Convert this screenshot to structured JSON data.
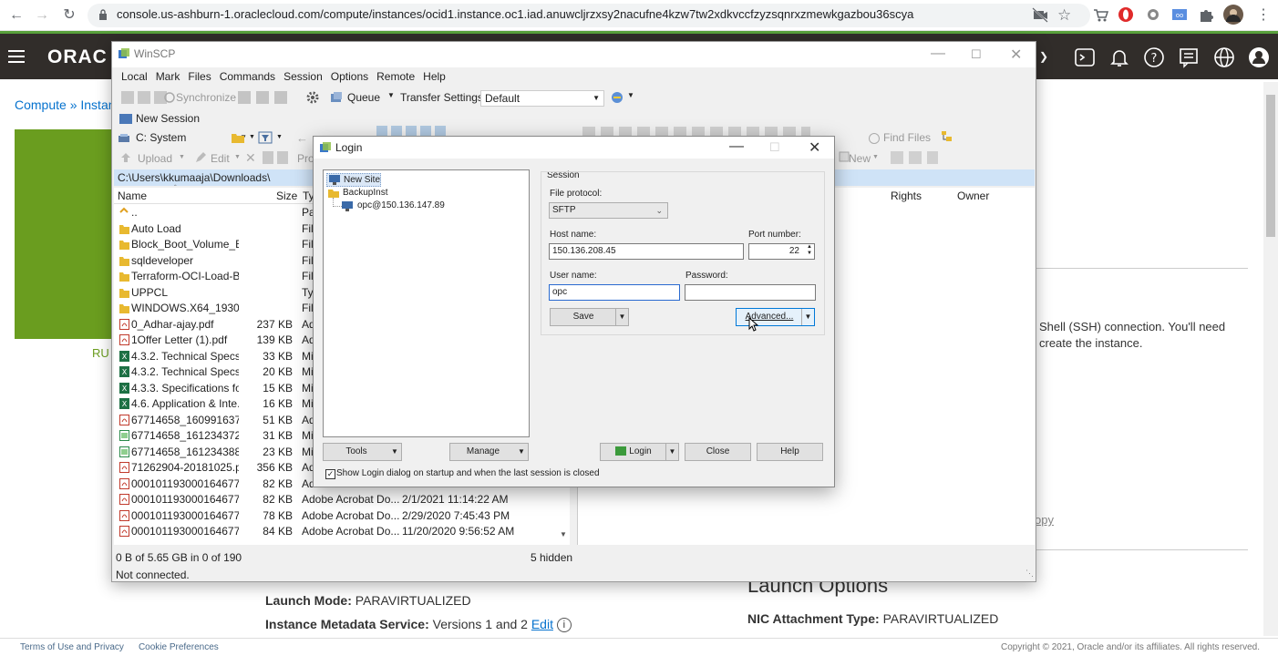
{
  "browser": {
    "url": "console.us-ashburn-1.oraclecloud.com/compute/instances/ocid1.instance.oc1.iad.anuwcljrzxsy2nacufne4kzw7tw2xdkvccfzyzsqnrxzmewkgazbou36scya"
  },
  "oci": {
    "logo": "ORAC",
    "breadcrumb": "Compute » Instanc",
    "run_label": "RU",
    "ssh_text": "Shell (SSH) connection. You'll need create the instance.",
    "copy_link": "opy",
    "launch_mode_label": "Launch Mode:",
    "launch_mode_value": "PARAVIRTUALIZED",
    "imds_label": "Instance Metadata Service:",
    "imds_value": "Versions 1 and 2",
    "imds_edit": "Edit",
    "launch_options": "Launch Options",
    "nic_label": "NIC Attachment Type:",
    "nic_value": "PARAVIRTUALIZED",
    "footer_terms": "Terms of Use and Privacy",
    "footer_cookies": "Cookie Preferences",
    "copyright": "Copyright © 2021, Oracle and/or its affiliates. All rights reserved."
  },
  "winscp": {
    "title": "WinSCP",
    "menu": [
      "Local",
      "Mark",
      "Files",
      "Commands",
      "Session",
      "Options",
      "Remote",
      "Help"
    ],
    "synchronize": "Synchronize",
    "queue": "Queue",
    "transfer_settings": "Transfer Settings",
    "transfer_value": "Default",
    "new_session": "New Session",
    "drive": "C: System",
    "upload": "Upload",
    "edit": "Edit",
    "pro": "Pro",
    "find_files": "Find Files",
    "new": "New",
    "path": "C:\\Users\\kkumaaja\\Downloads\\",
    "columns": {
      "name": "Name",
      "size": "Size",
      "type": "Ty",
      "rights": "Rights",
      "owner": "Owner"
    },
    "files": [
      {
        "name": "..",
        "size": "",
        "type": "Pa",
        "date": "",
        "icon": "up"
      },
      {
        "name": "Auto Load",
        "size": "",
        "type": "File",
        "date": "",
        "icon": "folder"
      },
      {
        "name": "Block_Boot_Volume_B...",
        "size": "",
        "type": "File",
        "date": "",
        "icon": "folder"
      },
      {
        "name": "sqldeveloper",
        "size": "",
        "type": "File",
        "date": "",
        "icon": "folder"
      },
      {
        "name": "Terraform-OCI-Load-B...",
        "size": "",
        "type": "File",
        "date": "",
        "icon": "folder"
      },
      {
        "name": "UPPCL",
        "size": "",
        "type": "Typ",
        "date": "",
        "icon": "folder"
      },
      {
        "name": "WINDOWS.X64_19300...",
        "size": "",
        "type": "File",
        "date": "",
        "icon": "folder"
      },
      {
        "name": "0_Adhar-ajay.pdf",
        "size": "237 KB",
        "type": "Ad",
        "date": "",
        "icon": "pdf"
      },
      {
        "name": "1Offer Letter (1).pdf",
        "size": "139 KB",
        "type": "Ad",
        "date": "",
        "icon": "pdf"
      },
      {
        "name": "4.3.2. Technical Specs f...",
        "size": "33 KB",
        "type": "Mi",
        "date": "",
        "icon": "xls"
      },
      {
        "name": "4.3.2. Technical Specs f...",
        "size": "20 KB",
        "type": "Mi",
        "date": "",
        "icon": "xls"
      },
      {
        "name": "4.3.3. Specifications fo...",
        "size": "15 KB",
        "type": "Mi",
        "date": "",
        "icon": "xls"
      },
      {
        "name": "4.6. Application & Inte...",
        "size": "16 KB",
        "type": "Mi",
        "date": "",
        "icon": "xls"
      },
      {
        "name": "67714658_160991637...",
        "size": "51 KB",
        "type": "Ad",
        "date": "",
        "icon": "pdf"
      },
      {
        "name": "67714658_161234372...",
        "size": "31 KB",
        "type": "Mi",
        "date": "",
        "icon": "img"
      },
      {
        "name": "67714658_161234388...",
        "size": "23 KB",
        "type": "Mi",
        "date": "",
        "icon": "img"
      },
      {
        "name": "71262904-20181025.p...",
        "size": "356 KB",
        "type": "Ad",
        "date": "",
        "icon": "pdf"
      },
      {
        "name": "000101193000164677...",
        "size": "82 KB",
        "type": "Adobe Acrobat Do...",
        "date": "",
        "icon": "pdf"
      },
      {
        "name": "000101193000164677...",
        "size": "82 KB",
        "type": "Adobe Acrobat Do...",
        "date": "2/1/2021  11:14:22 AM",
        "icon": "pdf"
      },
      {
        "name": "000101193000164677...",
        "size": "78 KB",
        "type": "Adobe Acrobat Do...",
        "date": "2/29/2020  7:45:43 PM",
        "icon": "pdf"
      },
      {
        "name": "000101193000164677...",
        "size": "84 KB",
        "type": "Adobe Acrobat Do...",
        "date": "11/20/2020  9:56:52 AM",
        "icon": "pdf"
      }
    ],
    "status_left": "0 B of 5.65 GB in 0 of 190",
    "status_hidden": "5 hidden",
    "status_conn": "Not connected."
  },
  "login": {
    "title": "Login",
    "tree": [
      {
        "label": "New Site",
        "level": 0,
        "icon": "site"
      },
      {
        "label": "BackupInst",
        "level": 0,
        "icon": "folder"
      },
      {
        "label": "opc@150.136.147.89",
        "level": 1,
        "icon": "site"
      }
    ],
    "session_label": "Session",
    "protocol_label": "File protocol:",
    "protocol_value": "SFTP",
    "host_label": "Host name:",
    "host_value": "150.136.208.45",
    "port_label": "Port number:",
    "port_value": "22",
    "user_label": "User name:",
    "user_value": "opc",
    "password_label": "Password:",
    "password_value": "",
    "save": "Save",
    "advanced": "Advanced...",
    "tools": "Tools",
    "manage": "Manage",
    "login_btn": "Login",
    "close_btn": "Close",
    "help_btn": "Help",
    "show_login_check": "Show Login dialog on startup and when the last session is closed",
    "show_login_checked": true
  }
}
